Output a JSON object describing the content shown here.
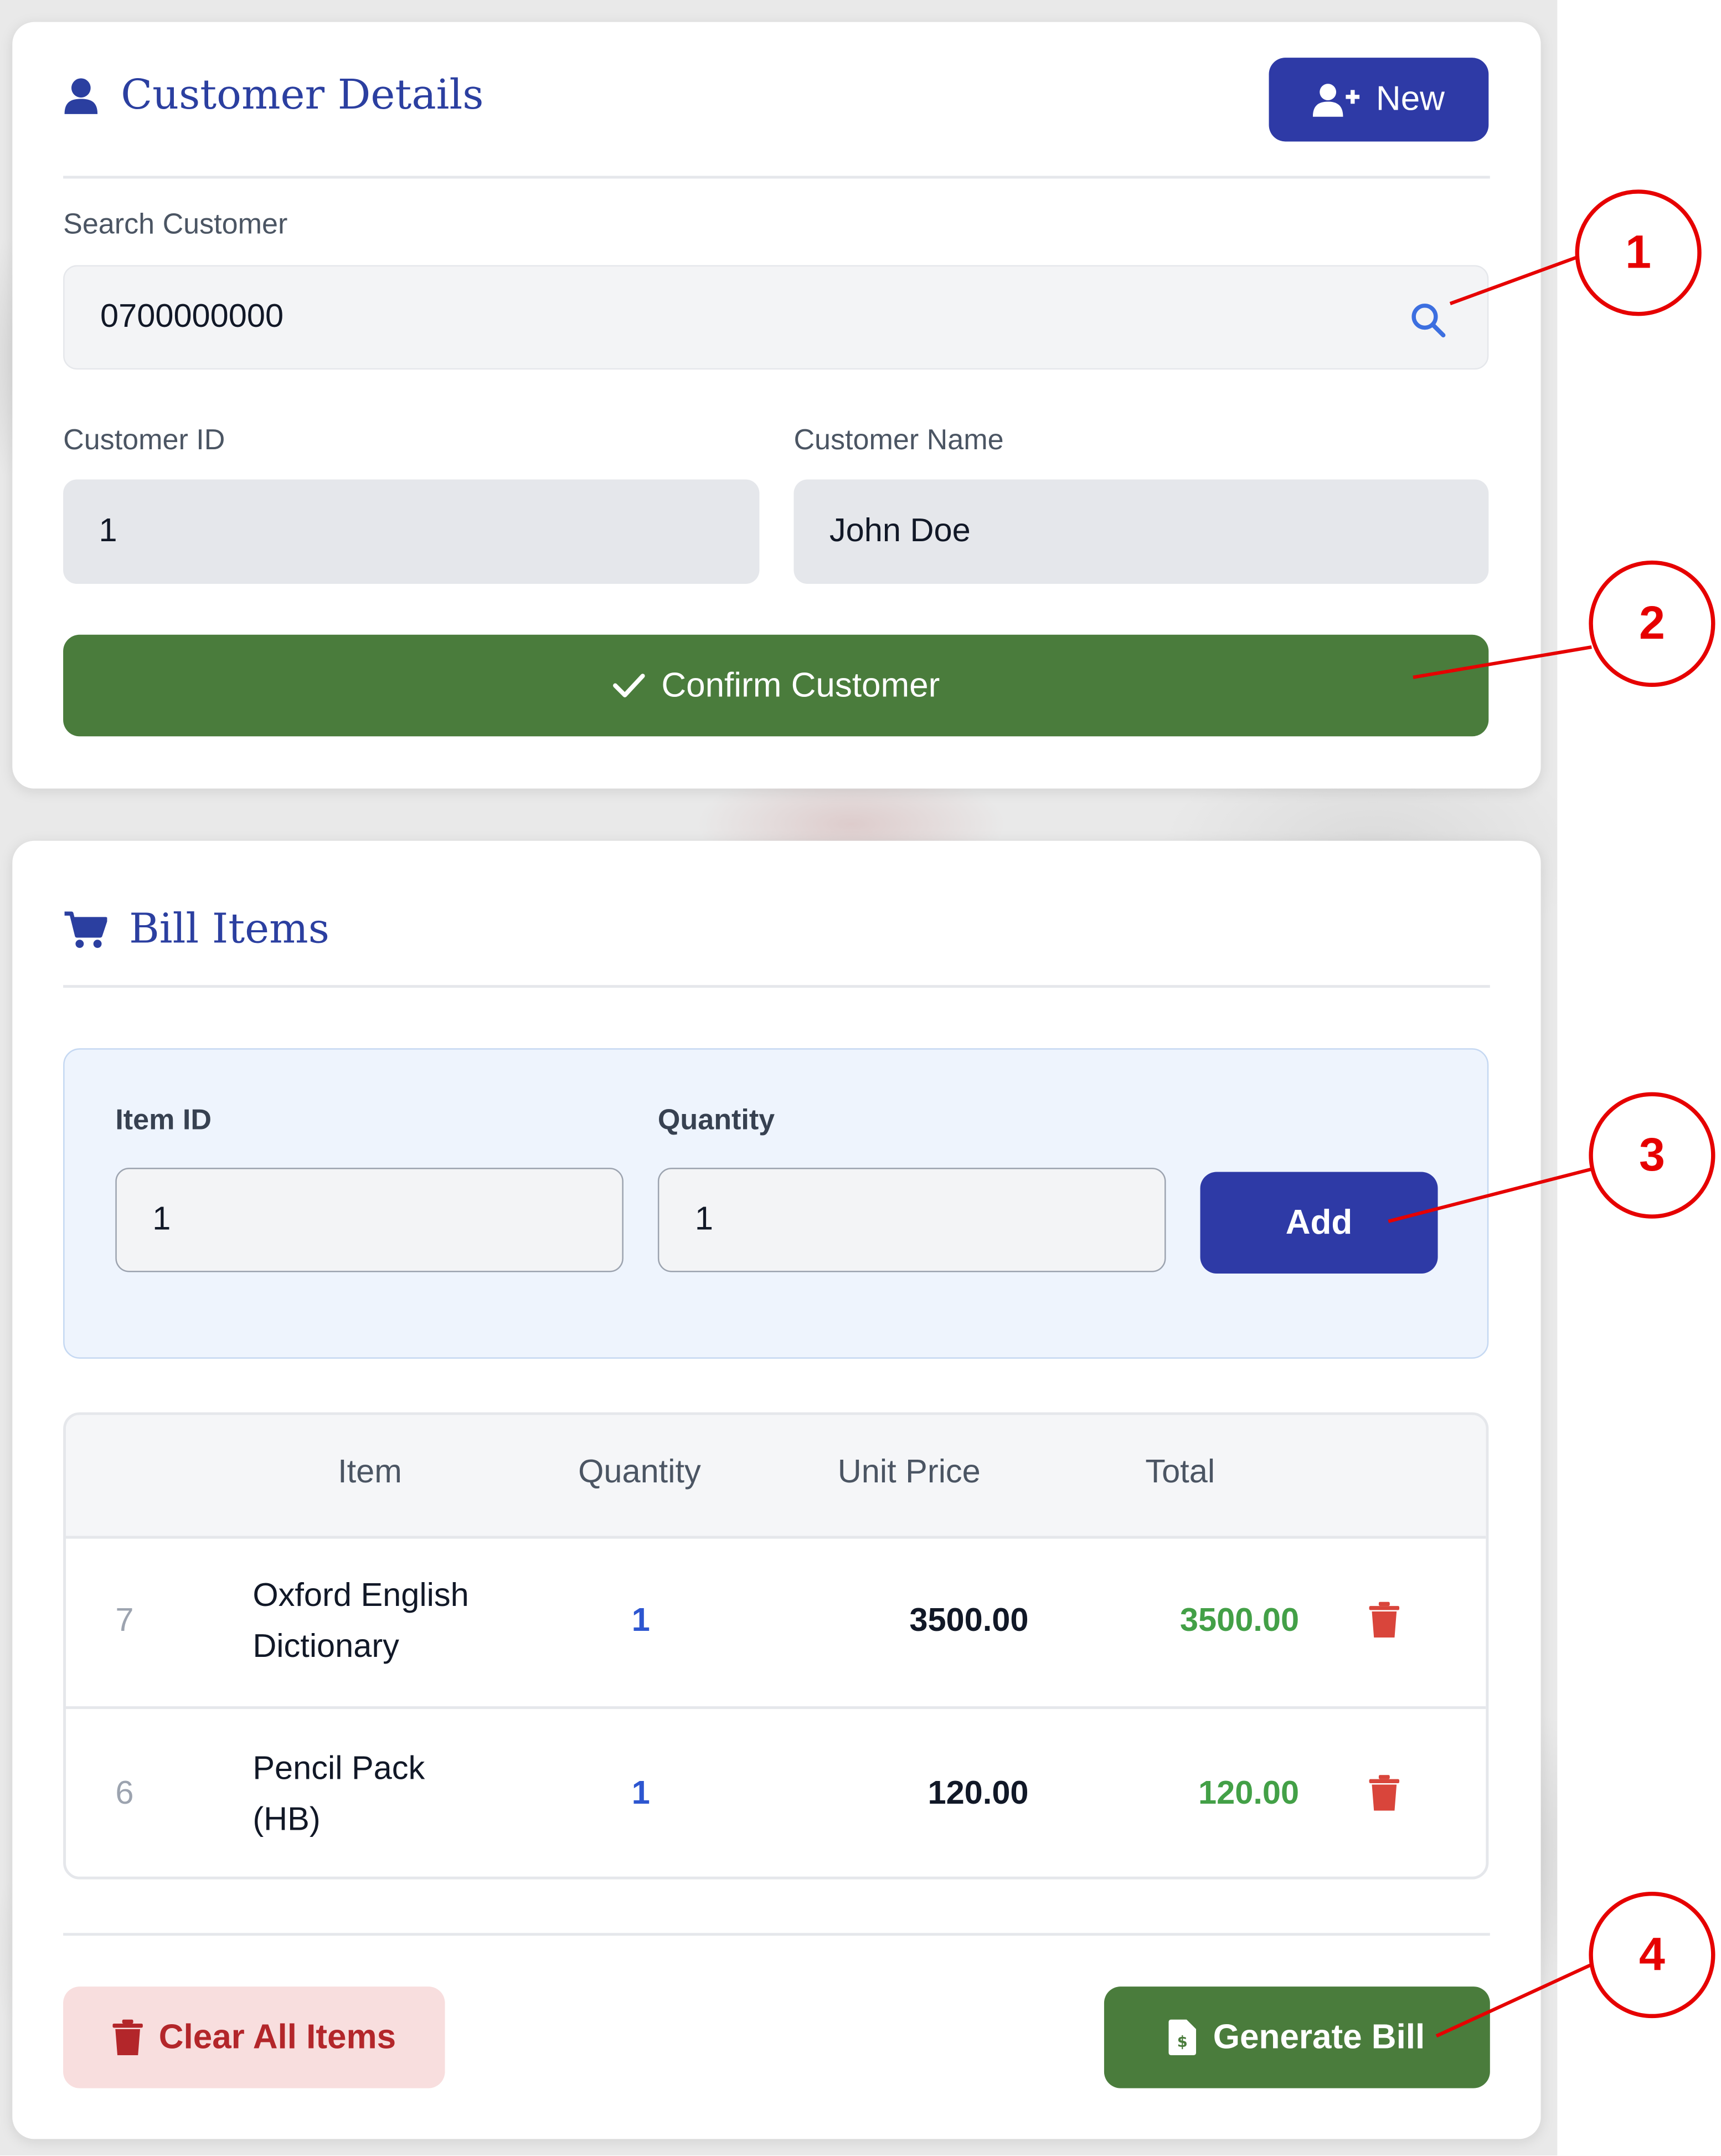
{
  "customer": {
    "title": "Customer Details",
    "new_button": "New",
    "search_label": "Search Customer",
    "search_value": "0700000000",
    "id_label": "Customer ID",
    "id_value": "1",
    "name_label": "Customer Name",
    "name_value": "John Doe",
    "confirm_button": "Confirm Customer"
  },
  "bill": {
    "title": "Bill Items",
    "item_id_label": "Item ID",
    "item_id_value": "1",
    "quantity_label": "Quantity",
    "quantity_value": "1",
    "add_button": "Add",
    "columns": [
      "Item",
      "Quantity",
      "Unit Price",
      "Total"
    ],
    "rows": [
      {
        "index": "7",
        "name_line1": "Oxford English",
        "name_line2": "Dictionary",
        "quantity": "1",
        "unit_price": "3500.00",
        "total": "3500.00"
      },
      {
        "index": "6",
        "name_line1": "Pencil Pack",
        "name_line2": "(HB)",
        "quantity": "1",
        "unit_price": "120.00",
        "total": "120.00"
      }
    ],
    "clear_button": "Clear All Items",
    "generate_button": "Generate Bill"
  },
  "callouts": [
    "1",
    "2",
    "3",
    "4"
  ],
  "colors": {
    "primary_blue": "#2e3aa6",
    "confirm_green": "#4a7c3c",
    "total_green": "#43a047",
    "danger_red": "#d9453b",
    "callout_red": "#e60000"
  },
  "icons": {
    "customer_title": "user-icon",
    "new_button": "user-plus-icon",
    "search": "search-icon",
    "confirm": "check-icon",
    "bill_title": "cart-icon",
    "row_delete": "trash-icon",
    "clear": "trash-icon",
    "generate": "invoice-icon"
  }
}
